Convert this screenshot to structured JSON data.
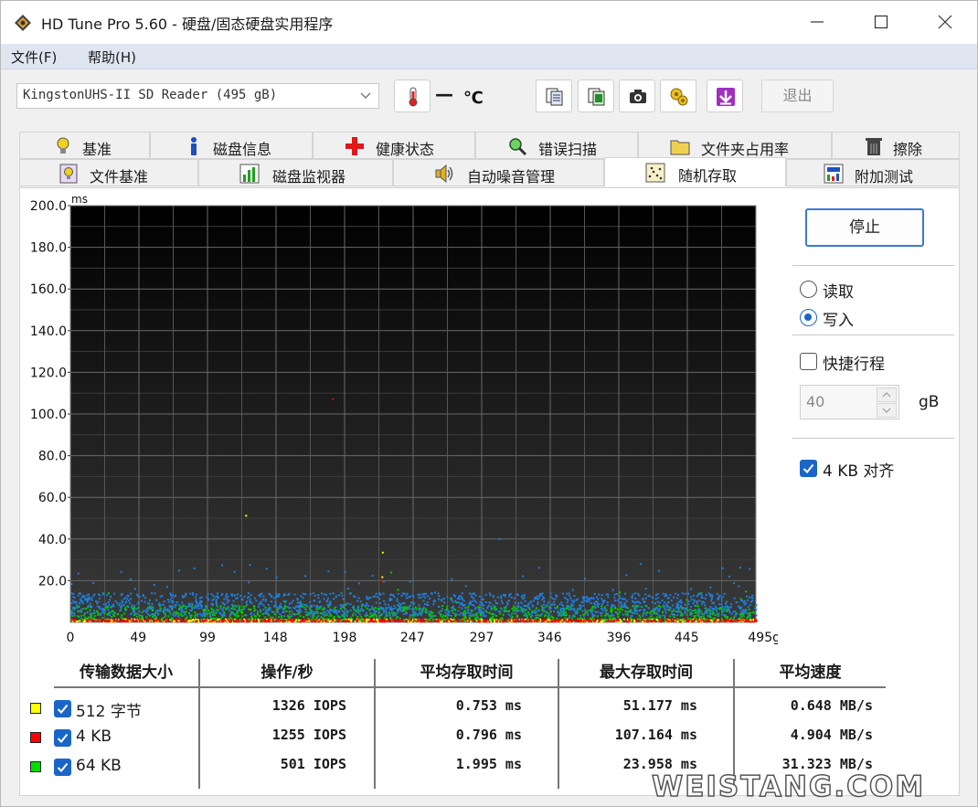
{
  "window": {
    "title": "HD Tune Pro 5.60 - 硬盘/固态硬盘实用程序"
  },
  "menu": {
    "file": "文件(F)",
    "help": "帮助(H)"
  },
  "toolbar": {
    "drive": "KingstonUHS-II SD Reader (495 gB)",
    "temperature": "—",
    "exit_label": "退出",
    "icons": [
      "thermometer-icon",
      "copy-text-icon",
      "copy-screen-icon",
      "camera-icon",
      "options-icon",
      "download-icon"
    ]
  },
  "tabs_row1": [
    {
      "label": "基准",
      "icon": "bulb-icon"
    },
    {
      "label": "磁盘信息",
      "icon": "info-icon"
    },
    {
      "label": "健康状态",
      "icon": "health-cross-icon"
    },
    {
      "label": "错误扫描",
      "icon": "magnifier-icon"
    },
    {
      "label": "文件夹占用率",
      "icon": "folder-icon"
    },
    {
      "label": "擦除",
      "icon": "trash-icon"
    }
  ],
  "tabs_row2": [
    {
      "label": "文件基准",
      "icon": "file-bulb-icon"
    },
    {
      "label": "磁盘监视器",
      "icon": "monitor-chart-icon"
    },
    {
      "label": "自动噪音管理",
      "icon": "speaker-icon"
    },
    {
      "label": "随机存取",
      "icon": "scatter-icon",
      "active": true
    },
    {
      "label": "附加测试",
      "icon": "extra-test-icon"
    }
  ],
  "controls": {
    "stop_label": "停止",
    "read_label": "读取",
    "write_label": "写入",
    "mode_selected": "写入",
    "quick_label": "快捷行程",
    "quick_checked": false,
    "quick_value": "40",
    "quick_unit": "gB",
    "align_label": "4 KB 对齐",
    "align_checked": true
  },
  "chart_data": {
    "type": "scatter",
    "ylabel": "ms",
    "ylim": [
      0,
      200
    ],
    "yticks": [
      "200.0",
      "180.0",
      "160.0",
      "140.0",
      "120.0",
      "100.0",
      "80.0",
      "60.0",
      "40.0",
      "20.0"
    ],
    "xlim": [
      0,
      495
    ],
    "xticks": [
      "0",
      "49",
      "99",
      "148",
      "198",
      "247",
      "297",
      "346",
      "396",
      "445",
      "495gB"
    ],
    "background": "#1c1c1c",
    "grid": true,
    "series": [
      {
        "name": "512 字节",
        "color": "#ffff00",
        "typical_ms": 0.753,
        "max_ms": 51.177,
        "band_ms": [
          0.3,
          1.5
        ]
      },
      {
        "name": "4 KB",
        "color": "#ff0000",
        "typical_ms": 0.796,
        "max_ms": 107.164,
        "band_ms": [
          0.3,
          1.5
        ]
      },
      {
        "name": "64 KB",
        "color": "#00cc00",
        "typical_ms": 1.995,
        "max_ms": 23.958,
        "band_ms": [
          1.0,
          8.0
        ]
      },
      {
        "name": "",
        "color": "#1e7fe0",
        "typical_ms": 8.0,
        "max_ms": 40.0,
        "band_ms": [
          3.0,
          14.0
        ]
      }
    ]
  },
  "table": {
    "headers": [
      "传输数据大小",
      "操作/秒",
      "平均存取时间",
      "最大存取时间",
      "平均速度"
    ],
    "rows": [
      {
        "size": "512 字节",
        "color": "#ffff00",
        "ops": "1326 IOPS",
        "avg": "0.753 ms",
        "max": "51.177 ms",
        "speed": "0.648 MB/s"
      },
      {
        "size": "4 KB",
        "color": "#ff0000",
        "ops": "1255 IOPS",
        "avg": "0.796 ms",
        "max": "107.164 ms",
        "speed": "4.904 MB/s"
      },
      {
        "size": "64 KB",
        "color": "#00dd00",
        "ops": "501 IOPS",
        "avg": "1.995 ms",
        "max": "23.958 ms",
        "speed": "31.323 MB/s"
      }
    ]
  },
  "watermark": "WEISTANG.COM"
}
